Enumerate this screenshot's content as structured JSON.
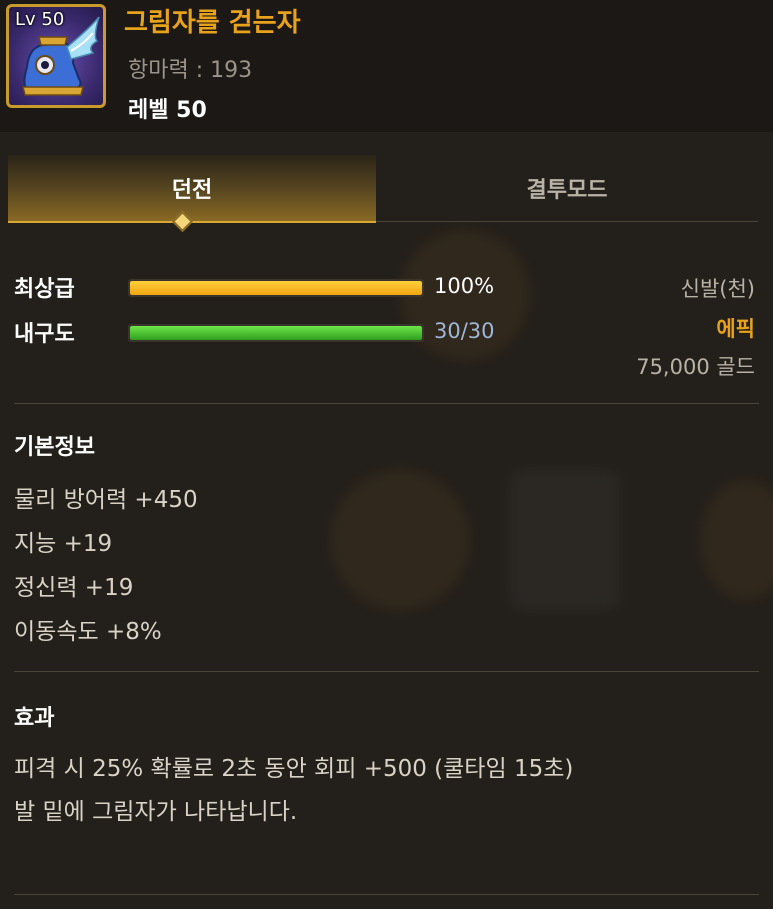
{
  "item": {
    "level_badge": "Lv 50",
    "name": "그림자를 걷는자",
    "magic_resist": "항마력 : 193",
    "required_level": "레벨 50"
  },
  "tabs": [
    {
      "label": "던전",
      "active": true
    },
    {
      "label": "결투모드",
      "active": false
    }
  ],
  "stats": {
    "quality": {
      "label": "최상급",
      "value": "100%",
      "percent": 100
    },
    "durability": {
      "label": "내구도",
      "value": "30/30",
      "percent": 100
    }
  },
  "meta": {
    "type": "신발(천)",
    "rarity": "에픽",
    "price": "75,000 골드"
  },
  "basic_info": {
    "title": "기본정보",
    "lines": [
      "물리 방어력 +450",
      "지능 +19",
      "정신력 +19",
      "이동속도 +8%"
    ]
  },
  "effect": {
    "title": "효과",
    "lines": [
      "피격 시 25% 확률로 2초 동안 회피 +500 (쿨타임 15초)",
      "발 밑에 그림자가 나타납니다."
    ]
  },
  "colors": {
    "rarity_epic": "#e8a21c",
    "quality_bar": "#f0a512",
    "durability_bar": "#2f9e1e",
    "durability_text": "#9fb7d6"
  },
  "icons": {
    "item": "winged-shoe-icon"
  }
}
